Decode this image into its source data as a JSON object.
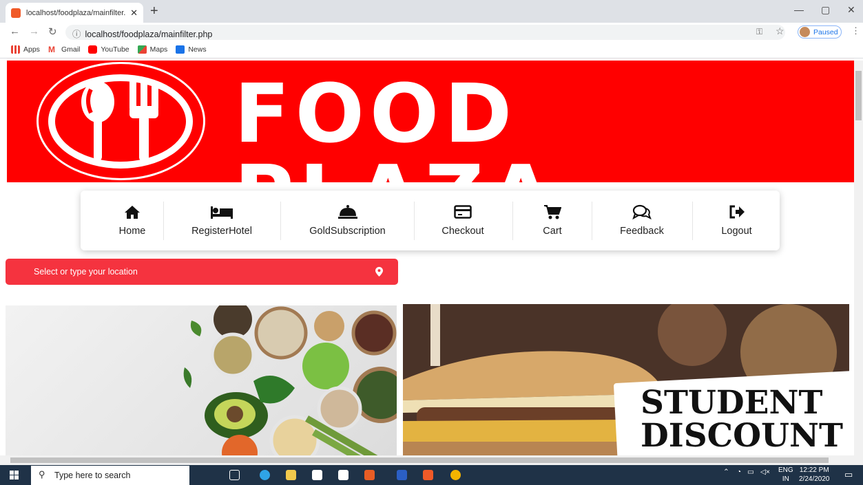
{
  "browser": {
    "tab_title": "localhost/foodplaza/mainfilter.pl",
    "url": "localhost/foodplaza/mainfilter.php",
    "profile_status": "Paused",
    "bookmarks": [
      "Apps",
      "Gmail",
      "YouTube",
      "Maps",
      "News"
    ]
  },
  "banner": {
    "brand_text": "FOOD PLAZA"
  },
  "nav": {
    "items": [
      {
        "label": "Home",
        "icon": "home-icon"
      },
      {
        "label": "RegisterHotel",
        "icon": "bed-icon"
      },
      {
        "label": "GoldSubscription",
        "icon": "service-bell-icon"
      },
      {
        "label": "Checkout",
        "icon": "credit-card-icon"
      },
      {
        "label": "Cart",
        "icon": "cart-icon"
      },
      {
        "label": "Feedback",
        "icon": "comments-icon"
      },
      {
        "label": "Logout",
        "icon": "sign-out-icon"
      }
    ]
  },
  "location": {
    "placeholder": "Select or type your location",
    "icon": "map-marker-icon"
  },
  "promo": {
    "right_text_line1": "STUDENT",
    "right_text_line2": "DISCOUNT"
  },
  "taskbar": {
    "search_placeholder": "Type here to search",
    "lang_line1": "ENG",
    "lang_line2": "IN",
    "time": "12:22 PM",
    "date": "2/24/2020"
  },
  "colors": {
    "brand_red": "#ff0000",
    "location_bar": "#f5333f"
  }
}
